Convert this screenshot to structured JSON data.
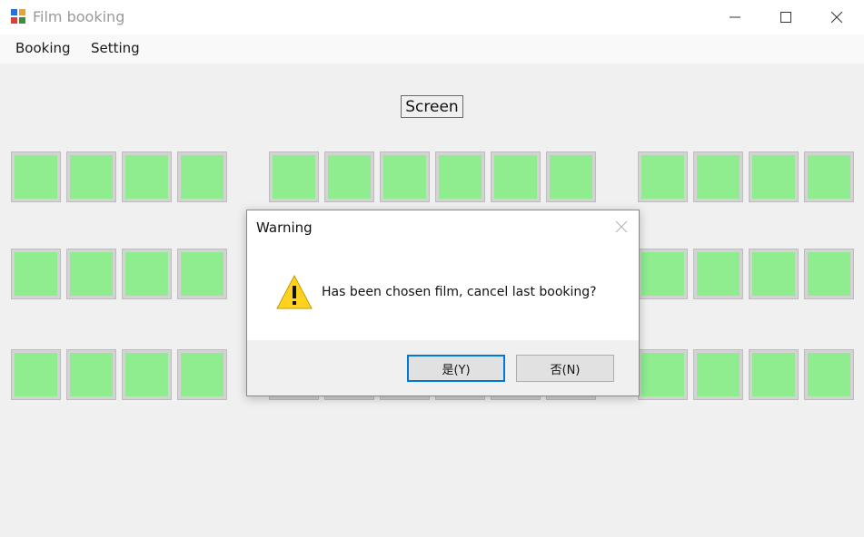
{
  "window": {
    "title": "Film booking",
    "icon": "app-icon",
    "controls": [
      "minimize-icon",
      "maximize-icon",
      "close-icon"
    ]
  },
  "menu": {
    "items": [
      {
        "label": "Booking"
      },
      {
        "label": "Setting"
      }
    ]
  },
  "screen": {
    "label": "Screen"
  },
  "seats": {
    "rows": 3,
    "columns_per_block": [
      4,
      6,
      4
    ],
    "color": "#8fec8f"
  },
  "dialog": {
    "title": "Warning",
    "icon": "warning-icon",
    "message": "Has been chosen film, cancel last booking?",
    "buttons": [
      {
        "label": "是(Y)",
        "default": true
      },
      {
        "label": "否(N)",
        "default": false
      }
    ]
  }
}
